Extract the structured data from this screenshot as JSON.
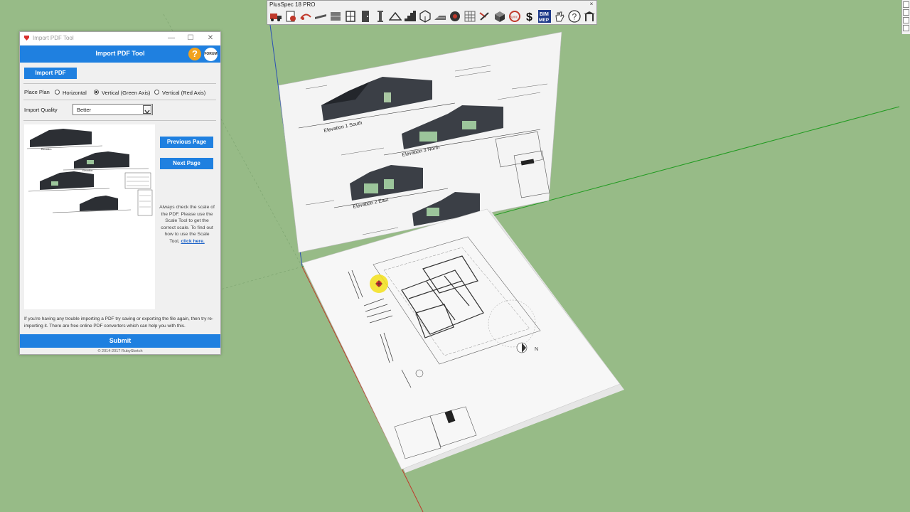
{
  "toolbar": {
    "title": "PlusSpec 18 PRO",
    "close": "×",
    "icons": [
      "truck-icon",
      "pdf-icon",
      "wand-icon",
      "beam-icon",
      "wall-icon",
      "window-icon",
      "door-icon",
      "column-icon",
      "roof-icon",
      "stair-icon",
      "cube-icon",
      "slab-icon",
      "render-icon",
      "grid-icon",
      "tools-icon",
      "box-icon",
      "sync-icon",
      "dollar-icon",
      "bim-icon",
      "hand-icon",
      "help-icon",
      "shed-icon"
    ],
    "sync_label": "sync",
    "dollar_label": "$",
    "bim_label": "BIM",
    "mep_label": "MEP",
    "help_label": "?"
  },
  "dialog": {
    "window_title": "Import PDF Tool",
    "min": "—",
    "max": "☐",
    "close": "✕",
    "header": "Import PDF Tool",
    "help": "?",
    "forum": "FORUM",
    "import_button": "Import PDF",
    "place_plan_label": "Place Plan",
    "options": [
      {
        "label": "Horizontal",
        "selected": false
      },
      {
        "label": "Vertical (Green Axis)",
        "selected": true
      },
      {
        "label": "Vertical (Red Axis)",
        "selected": false
      }
    ],
    "quality_label": "Import Quality",
    "quality_value": "Better",
    "prev_button": "Previous Page",
    "next_button": "Next Page",
    "scale_note": "Always check the scale of the PDF. Please use the Scale Tool to get the correct scale. To find out how to use the Scale Tool,",
    "scale_link": "click here.",
    "trouble_note": "If you're having any trouble importing a PDF try saving or exporting the file again, then try re-importing it. There are free online PDF converters which can help you with this.",
    "submit": "Submit",
    "copyright": "© 2014-2017 RubySketch"
  },
  "drawing": {
    "elev1": "Elevation 1 South",
    "elev3": "Elevation 3 North",
    "elev2": "Elevation 2 East",
    "north": "N",
    "prev_elev1": "Elevation",
    "prev_elev2": "Elevation"
  },
  "colors": {
    "ground": "#97bb87",
    "accent": "#1f80e0",
    "help": "#f2a21d"
  }
}
